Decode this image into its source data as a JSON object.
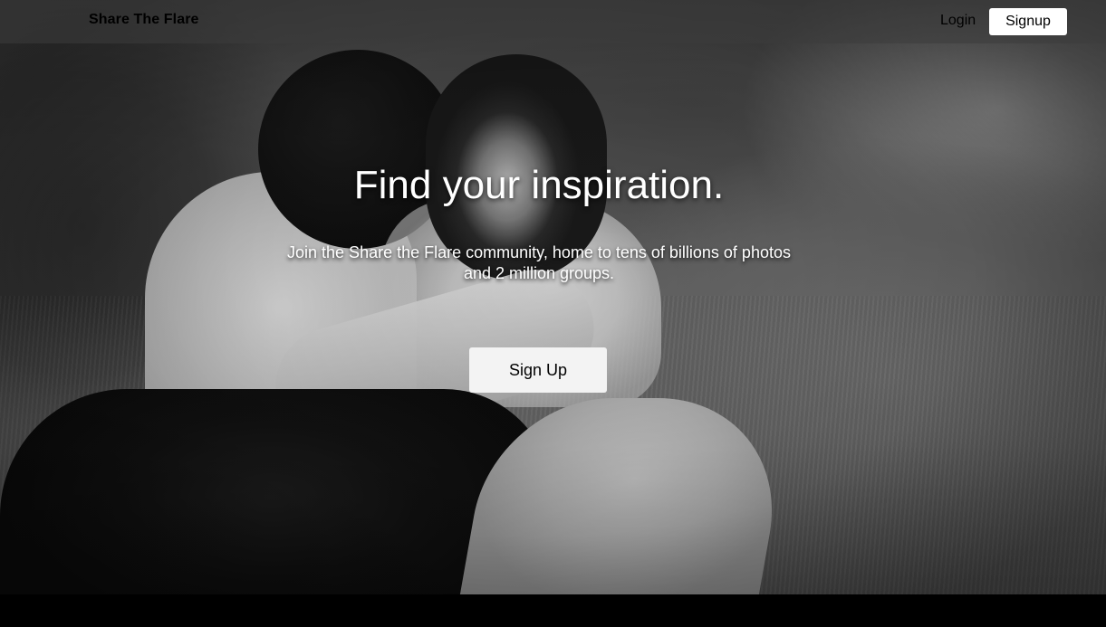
{
  "header": {
    "brand": "Share The Flare",
    "login_label": "Login",
    "signup_label": "Signup"
  },
  "hero": {
    "headline": "Find your inspiration.",
    "subhead": "Join the Share the Flare community, home to tens of billions of photos and 2 million groups.",
    "cta_label": "Sign Up",
    "image": {
      "style": "black-and-white photo"
    }
  },
  "colors": {
    "nav_bg": "#3C3C3C",
    "text_light": "#FFFFFF",
    "button_bg": "#F3F3F3",
    "footer_bg": "#000000"
  }
}
